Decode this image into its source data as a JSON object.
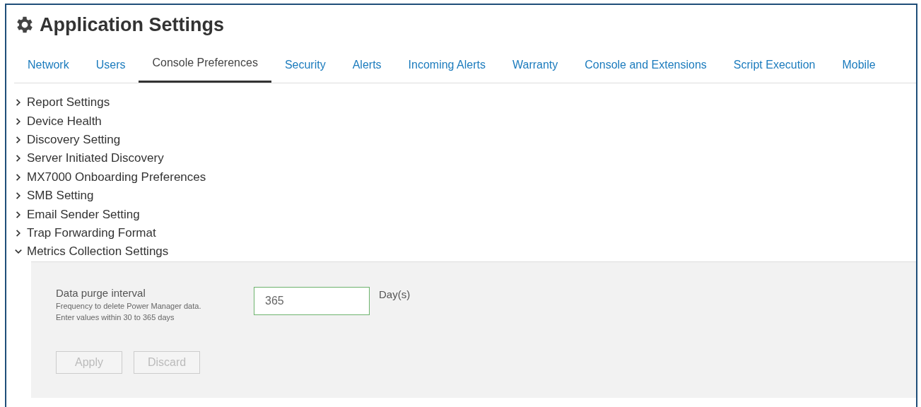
{
  "window": {
    "title": "Application Settings"
  },
  "tabs": [
    {
      "label": "Network",
      "selected": false
    },
    {
      "label": "Users",
      "selected": false
    },
    {
      "label": "Console Preferences",
      "selected": true
    },
    {
      "label": "Security",
      "selected": false
    },
    {
      "label": "Alerts",
      "selected": false
    },
    {
      "label": "Incoming Alerts",
      "selected": false
    },
    {
      "label": "Warranty",
      "selected": false
    },
    {
      "label": "Console and Extensions",
      "selected": false
    },
    {
      "label": "Script Execution",
      "selected": false
    },
    {
      "label": "Mobile",
      "selected": false
    }
  ],
  "sections": [
    {
      "title": "Report Settings",
      "expanded": false
    },
    {
      "title": "Device Health",
      "expanded": false
    },
    {
      "title": "Discovery Setting",
      "expanded": false
    },
    {
      "title": "Server Initiated Discovery",
      "expanded": false
    },
    {
      "title": "MX7000 Onboarding Preferences",
      "expanded": false
    },
    {
      "title": "SMB Setting",
      "expanded": false
    },
    {
      "title": "Email Sender Setting",
      "expanded": false
    },
    {
      "title": "Trap Forwarding Format",
      "expanded": false
    },
    {
      "title": "Metrics Collection Settings",
      "expanded": true
    }
  ],
  "metrics_panel": {
    "label": "Data purge interval",
    "help": [
      "Frequency to delete Power Manager data.",
      "Enter values within 30 to 365 days"
    ],
    "value": "365",
    "unit": "Day(s)",
    "buttons": [
      {
        "label": "Apply",
        "disabled": true
      },
      {
        "label": "Discard",
        "disabled": true
      }
    ]
  }
}
